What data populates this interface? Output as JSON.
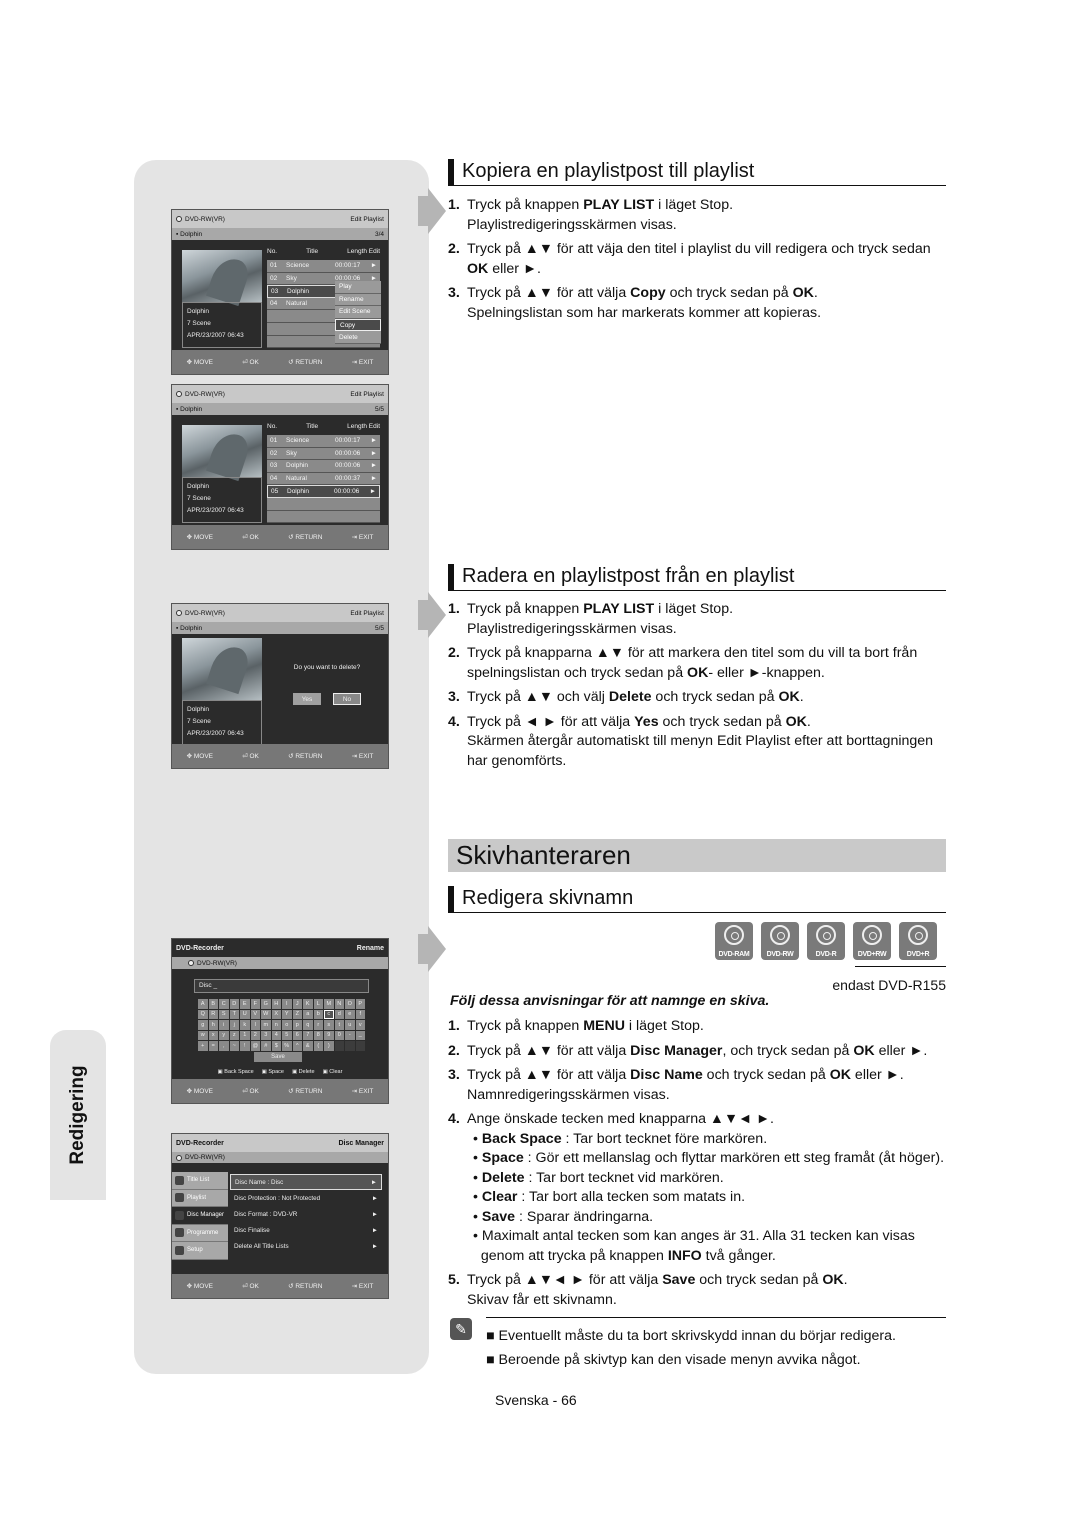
{
  "side_tab": {
    "label": "Redigering"
  },
  "section1": {
    "title": "Kopiera en playlistpost till playlist",
    "steps": [
      {
        "n": "1.",
        "html": "Tryck på knappen <b>PLAY LIST</b> i läget Stop.<br>Playlistredigeringsskärmen visas."
      },
      {
        "n": "2.",
        "html": "Tryck på ▲▼ för att väja den titel i playlist du vill redigera och tryck sedan <b>OK</b> eller ►."
      },
      {
        "n": "3.",
        "html": "Tryck på ▲▼ för att välja <b>Copy</b> och tryck sedan på <b>OK</b>.<br>Spelningslistan som har markerats kommer att kopieras."
      }
    ]
  },
  "section2": {
    "title": "Radera en playlistpost från en playlist",
    "steps": [
      {
        "n": "1.",
        "html": "Tryck på knappen <b>PLAY LIST</b> i läget Stop.<br>Playlistredigeringsskärmen visas."
      },
      {
        "n": "2.",
        "html": "Tryck på knapparna ▲▼ för att markera den titel som du vill ta bort från spelningslistan och tryck sedan på <b>OK</b>- eller ►-knappen."
      },
      {
        "n": "3.",
        "html": "Tryck på ▲▼ och välj <b>Delete</b> och tryck sedan på <b>OK</b>."
      },
      {
        "n": "4.",
        "html": "Tryck på ◄ ► för att välja <b>Yes</b> och tryck sedan på <b>OK</b>.<br>Skärmen återgår automatiskt till menyn Edit Playlist efter att borttagningen har genomförts."
      }
    ]
  },
  "section3": {
    "main_title": "Skivhanteraren",
    "title": "Redigera skivnamn",
    "badges": [
      "DVD-RAM",
      "DVD-RW",
      "DVD-R",
      "DVD+RW",
      "DVD+R"
    ],
    "only_note": "endast DVD-R155",
    "intro": "Följ dessa anvisningar för att namnge en skiva.",
    "steps": [
      {
        "n": "1.",
        "html": "Tryck på knappen <b>MENU</b> i läget Stop."
      },
      {
        "n": "2.",
        "html": "Tryck på ▲▼ för att välja <b>Disc Manager</b>, och tryck sedan på <b>OK</b> eller ►."
      },
      {
        "n": "3.",
        "html": "Tryck på ▲▼ för att välja <b>Disc Name</b> och tryck sedan på <b>OK</b> eller ►.<br>Namnredigeringsskärmen visas."
      },
      {
        "n": "4.",
        "html": "Ange önskade tecken med knapparna ▲▼◄ ►.<div class='bul'>• <b>Back Space</b> : Tar bort tecknet före markören.<br>• <b>Space</b> : Gör ett mellanslag och flyttar markören ett steg framåt (åt höger).<br>• <b>Delete</b> : Tar bort tecknet vid markören.<br>• <b>Clear</b> : Tar bort alla tecken som matats in.<br>• <b>Save</b> : Sparar ändringarna.<br>• Maximalt antal tecken som kan anges är 31. Alla 31 tecken kan visas<br>&nbsp;&nbsp;genom att trycka på knappen <b>INFO</b> två gånger.</div>"
      },
      {
        "n": "5.",
        "html": "Tryck på ▲▼◄ ► för att välja <b>Save</b> och tryck sedan på <b>OK</b>.<br>Skivav får ett skivnamn."
      }
    ],
    "notes": [
      "Eventuellt måste du ta bort skrivskydd innan du börjar redigera.",
      "Beroende på skivtyp kan den visade menyn avvika något."
    ]
  },
  "footer": {
    "page": "Svenska - 66"
  },
  "osd_common": {
    "disc": "DVD-RW(VR)",
    "edit_playlist": "Edit Playlist",
    "playlist_name": "Dolphin",
    "info_name": "Dolphin",
    "info_scenes": "7 Scene",
    "info_date": "APR/23/2007 06:43",
    "col_no": "No.",
    "col_title": "Title",
    "col_length": "Length Edit",
    "foot": [
      "MOVE",
      "OK",
      "RETURN",
      "EXIT"
    ]
  },
  "screen1": {
    "page": "3/4",
    "rows": [
      {
        "no": "01",
        "title": "Science",
        "len": "00:00:17"
      },
      {
        "no": "02",
        "title": "Sky",
        "len": "00:00:06"
      },
      {
        "no": "03",
        "title": "Dolphin",
        "len": ""
      },
      {
        "no": "04",
        "title": "Natural",
        "len": ""
      }
    ],
    "menu": [
      "Play",
      "Rename",
      "Edit Scene",
      "Copy",
      "Delete"
    ],
    "menu_selected": "Copy"
  },
  "screen2": {
    "page": "5/5",
    "rows": [
      {
        "no": "01",
        "title": "Science",
        "len": "00:00:17"
      },
      {
        "no": "02",
        "title": "Sky",
        "len": "00:00:06"
      },
      {
        "no": "03",
        "title": "Dolphin",
        "len": "00:00:06"
      },
      {
        "no": "04",
        "title": "Natural",
        "len": "00:00:37"
      },
      {
        "no": "05",
        "title": "Dolphin",
        "len": "00:00:06"
      }
    ]
  },
  "screen3": {
    "page": "5/5",
    "question": "Do you want to delete?",
    "yes": "Yes",
    "no": "No"
  },
  "screen4": {
    "title": "DVD-Recorder",
    "mode": "Rename",
    "name_value": "Disc _",
    "keys": [
      [
        "A",
        "B",
        "C",
        "D",
        "E",
        "F",
        "G",
        "H",
        "I",
        "J",
        "K",
        "L",
        "M",
        "N",
        "O",
        "P"
      ],
      [
        "Q",
        "R",
        "S",
        "T",
        "U",
        "V",
        "W",
        "X",
        "Y",
        "Z",
        "a",
        "b",
        "c",
        "d",
        "e",
        "f"
      ],
      [
        "g",
        "h",
        "i",
        "j",
        "k",
        "l",
        "m",
        "n",
        "o",
        "p",
        "q",
        "r",
        "s",
        "t",
        "u",
        "v"
      ],
      [
        "w",
        "x",
        "y",
        "z",
        "1",
        "2",
        "3",
        "4",
        "5",
        "6",
        "7",
        "8",
        "9",
        "0",
        "-",
        "_"
      ],
      [
        "+",
        "=",
        ",",
        "~",
        "!",
        "@",
        "#",
        "$",
        "%",
        "^",
        "&",
        "(",
        ")",
        "",
        "",
        ""
      ]
    ],
    "selected_key": "c",
    "save": "Save",
    "legend": [
      "Back Space",
      "Space",
      "Delete",
      "Clear"
    ]
  },
  "screen5": {
    "title": "DVD-Recorder",
    "mode": "Disc Manager",
    "side": [
      "Title List",
      "Playlist",
      "Disc Manager",
      "Programme",
      "Setup"
    ],
    "side_selected": "Disc Manager",
    "items": [
      "Disc Name : Disc",
      "Disc Protection : Not Protected",
      "Disc Format     : DVD-VR",
      "Disc Finalise",
      "Delete All Title Lists"
    ]
  }
}
